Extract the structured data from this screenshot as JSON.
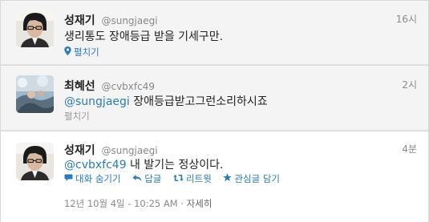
{
  "tweets": [
    {
      "name": "성재기",
      "handle": "@sungjaegi",
      "time": "16시",
      "text": "생리통도 장애등급 받을 기세구만.",
      "sub_label": "펼치기",
      "sub_icon": "location-pin-icon"
    },
    {
      "name": "최혜선",
      "handle": "@cvbxfc49",
      "time": "2시",
      "mention": "@sungjaegi",
      "text": " 장애등급받고그런소리하시죠",
      "sub_label": "펼치기"
    },
    {
      "name": "성재기",
      "handle": "@sungjaegi",
      "time": "4분",
      "mention": "@cvbxfc49",
      "text": " 내 발기는 정상이다.",
      "actions": {
        "hide_conversation": "대화 숨기기",
        "reply": "답글",
        "retweet": "리트윗",
        "favorite": "관심글 담기"
      },
      "timestamp": "12년 10월 4일 - 10:25 AM",
      "separator": " · ",
      "details": "자세히"
    }
  ],
  "colors": {
    "link": "#2a7bb6",
    "muted": "#888888"
  }
}
